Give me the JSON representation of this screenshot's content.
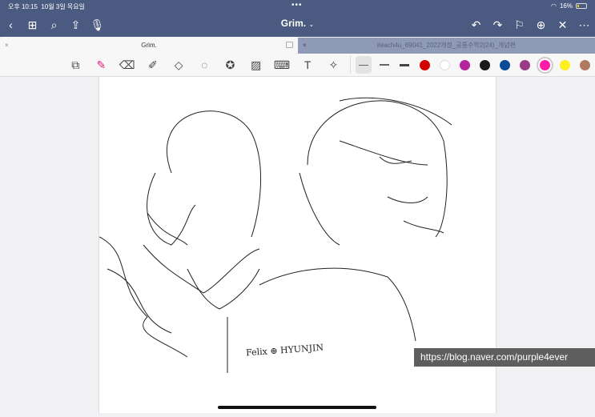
{
  "status": {
    "time": "오후 10:15",
    "date": "10월 3일 목요일",
    "battery": "16%",
    "battery_level": 0.16
  },
  "toolbar": {
    "title": "Grim.",
    "left_icons": [
      "back-icon",
      "grid-icon",
      "search-icon",
      "share-icon",
      "mic-icon"
    ],
    "right_icons": [
      "undo-icon",
      "redo-icon",
      "bookmark-icon",
      "add-page-icon",
      "close-icon",
      "more-icon"
    ]
  },
  "tabs": [
    {
      "label": "Grim.",
      "active": true
    },
    {
      "label": "iteach4u_69041_2022개정_공통수학2(24)_개념편",
      "active": false
    }
  ],
  "tools": [
    "lasso-zoom",
    "pen",
    "eraser",
    "highlighter",
    "shapes",
    "lasso",
    "elements",
    "image",
    "keyboard",
    "text",
    "laser"
  ],
  "colors": [
    "#d40000",
    "#ffffff",
    "#b5259e",
    "#1a1a1a",
    "#0b4a96",
    "#9b3b86",
    "#ff1aa8",
    "#ffee20",
    "#b07a5e"
  ],
  "selected_color": "#ff1aa8",
  "drawing": {
    "signature": "Felix ⊕ HYUNJIN"
  },
  "watermark": "https://blog.naver.com/purple4ever"
}
